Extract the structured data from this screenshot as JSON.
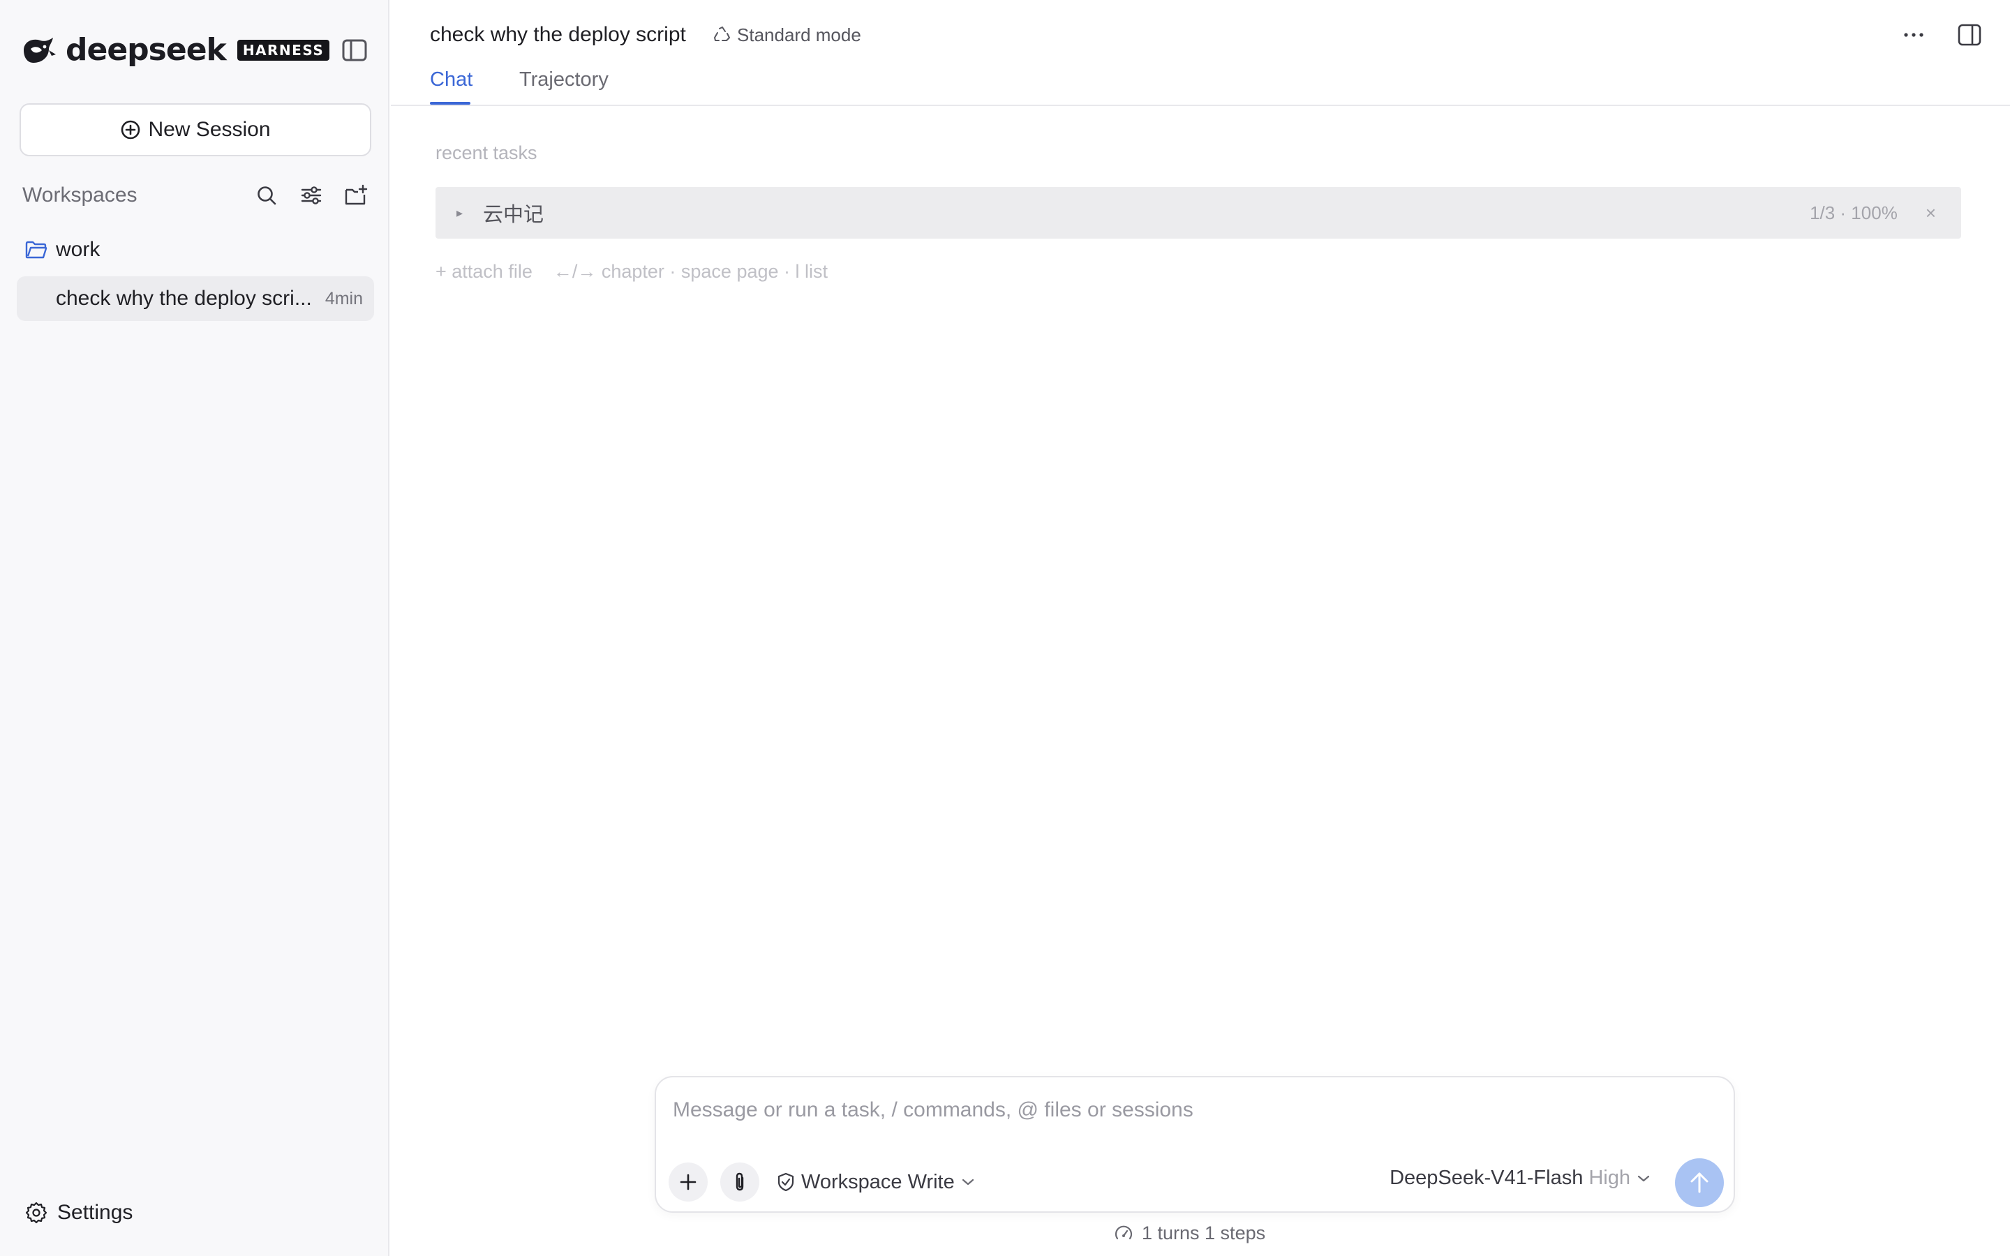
{
  "brand": {
    "name": "deepseek",
    "badge": "HARNESS"
  },
  "sidebar": {
    "new_session_label": "New Session",
    "workspaces_title": "Workspaces",
    "folder": {
      "name": "work",
      "icon": "folder-icon"
    },
    "sessions": [
      {
        "title": "check why the deploy scri...",
        "time": "4min"
      }
    ],
    "settings_label": "Settings"
  },
  "header": {
    "title": "check why the deploy script",
    "mode": "Standard mode",
    "tabs": [
      {
        "label": "Chat",
        "active": true
      },
      {
        "label": "Trajectory",
        "active": false
      }
    ]
  },
  "recent": {
    "label": "recent tasks",
    "tasks": [
      {
        "name": "云中记",
        "meta": "1/3 · 100%",
        "close": "×",
        "caret": "▸"
      }
    ],
    "hints": {
      "attach": "+ attach file",
      "nav": "←/→ chapter · space page · l list"
    }
  },
  "composer": {
    "placeholder": "Message or run a task, / commands, @ files or sessions",
    "value": "",
    "permission": "Workspace Write",
    "model": "DeepSeek-V41-Flash",
    "effort": "High"
  },
  "footer": {
    "turns": "1 turns 1 steps"
  },
  "colors": {
    "accent": "#3b67d6",
    "send_button": "#a9c3f3",
    "sidebar_bg": "#f8f8fa",
    "selected_row": "#ececef"
  }
}
